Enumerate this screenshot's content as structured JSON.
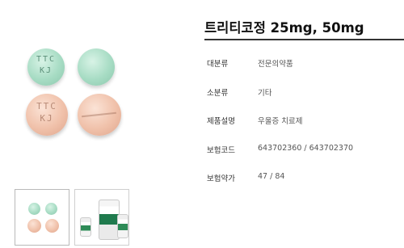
{
  "product": {
    "title": "트리티코정 25mg, 50mg"
  },
  "pill_imprints": {
    "green_line1": "TTC",
    "green_line2": "KJ",
    "pink_line1": "TTC",
    "pink_line2": "KJ"
  },
  "info_rows": [
    {
      "label": "대분류",
      "value": "전문의약품"
    },
    {
      "label": "소분류",
      "value": "기타"
    },
    {
      "label": "제품설명",
      "value": "우울증 치료제"
    },
    {
      "label": "보험코드",
      "value": "643702360 / 643702370"
    },
    {
      "label": "보험약가",
      "value": "47 / 84"
    }
  ],
  "thumbnails": [
    {
      "name": "pills-thumbnail",
      "active": true
    },
    {
      "name": "bottles-thumbnail",
      "active": false
    }
  ],
  "colors": {
    "pill_green": "#a7dcc4",
    "pill_pink": "#f0c1aa",
    "title_rule": "#333333"
  }
}
